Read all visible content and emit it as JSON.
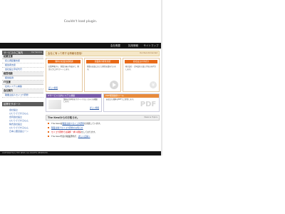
{
  "plugin": {
    "message": "Couldn't load plugin."
  },
  "navbar": {
    "items": [
      "会社概要",
      "採用情報",
      "サイトマップ"
    ]
  },
  "sidebar": {
    "header": "サービスのご案内",
    "header_sub": "Our Service",
    "sec1": "起業支援",
    "sec1_links": [
      "初心者起業支援",
      "経営者支援",
      "会社設立手続代行"
    ],
    "sec2": "経営相談",
    "sec2_links": [
      "経営指導"
    ],
    "sec3": "IT支援",
    "sec3_links": [
      "社内システム構築"
    ],
    "sec4": "会社案内",
    "sec4_links": [
      "職業主婦人セイコウ研修"
    ],
    "sub_header": "起業をサポート",
    "sub_links": [
      "会社設立",
      "ひとりでできるもん",
      "合同会社設立",
      "ひとりでできるもん",
      "株式会社設立",
      "ひとりでできるもん",
      "日本公庫資金ローン"
    ]
  },
  "main": {
    "tab_header": "会社に有って得する情報を配信!",
    "tab_sub": "Our Recommended",
    "cards": [
      {
        "title": "無料の起業支援相談",
        "text": "起業準備から、事業計画の作成まで、経営のプロがサポートします。",
        "link": "詳しい情報"
      },
      {
        "title": "創業後の経営支援",
        "text": "事業の成長に応じた経営支援を行います。",
        "link": ""
      },
      {
        "title": "会社設立の手続き",
        "text": "株式会社・合同会社の設立手続きを代行します。",
        "link": ""
      }
    ],
    "box_it": {
      "title": "ITサービス 社内システム構築",
      "text": "業務の効率化をサポートするシステムを構築します。",
      "link": "詳しい情報"
    },
    "box_pdf": {
      "title": "PDF特別提供ツール",
      "text": "お役立ち資料をPDFでご提供します。",
      "logo": "PDF"
    },
    "news_title": "The Kewlからのお知らせ。",
    "news_sub": "News & Topics",
    "news": [
      {
        "pre": "The Kewlは",
        "link": "職業主婦人セイコウ研修",
        "post": "を支援しています。"
      },
      {
        "pre": "",
        "link": "職業主婦人セイコウ研修のお知らせ",
        "post": ""
      },
      {
        "red": "セイコウ研修では講師・求人募集",
        "post": "をしております。"
      },
      {
        "pre": "The Kewl代表の職業研修が、",
        "link": "詳しい記事へ",
        "post": ""
      }
    ]
  },
  "footer": "COPYRIGHT(C) THE KEWL ALL RIGHTS RESERVED."
}
